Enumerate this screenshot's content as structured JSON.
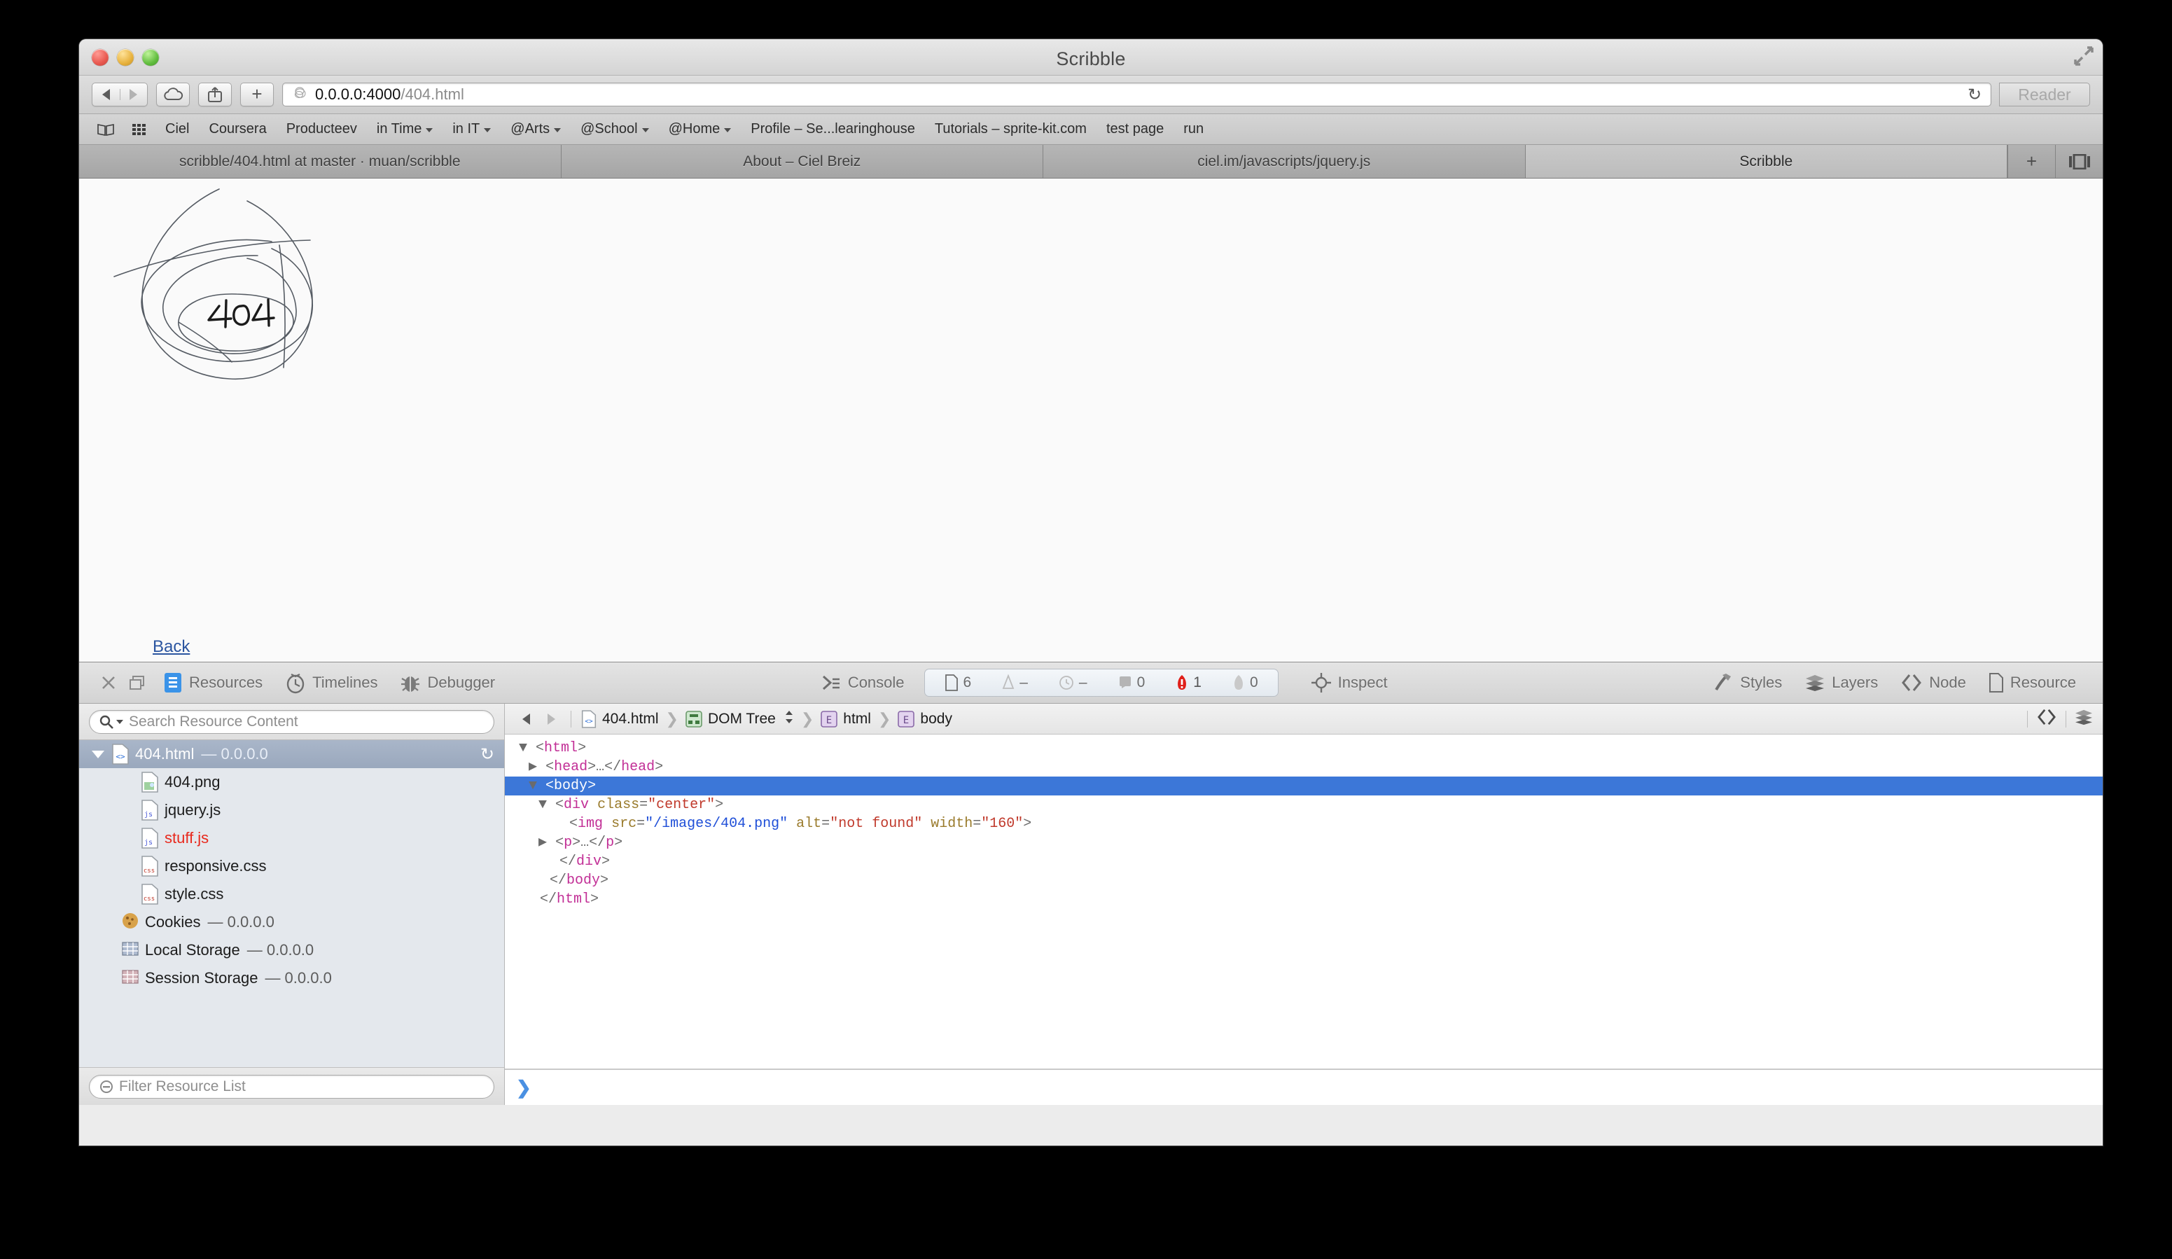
{
  "window": {
    "title": "Scribble"
  },
  "toolbar": {
    "url_host": "0.0.0.0:4000",
    "url_path": "/404.html",
    "reader_label": "Reader",
    "reload_glyph": "↻",
    "plus_glyph": "+"
  },
  "bookmarks": [
    {
      "label": "Ciel",
      "dropdown": false
    },
    {
      "label": "Coursera",
      "dropdown": false
    },
    {
      "label": "Producteev",
      "dropdown": false
    },
    {
      "label": "in Time",
      "dropdown": true
    },
    {
      "label": "in IT",
      "dropdown": true
    },
    {
      "label": "@Arts",
      "dropdown": true
    },
    {
      "label": "@School",
      "dropdown": true
    },
    {
      "label": "@Home",
      "dropdown": true
    },
    {
      "label": "Profile – Se...learinghouse",
      "dropdown": false
    },
    {
      "label": "Tutorials – sprite-kit.com",
      "dropdown": false
    },
    {
      "label": "test page",
      "dropdown": false
    },
    {
      "label": "run",
      "dropdown": false
    }
  ],
  "tabs": [
    {
      "label": "scribble/404.html at master · muan/scribble",
      "active": false
    },
    {
      "label": "About – Ciel Breiz",
      "active": false
    },
    {
      "label": "ciel.im/javascripts/jquery.js",
      "active": false
    },
    {
      "label": "Scribble",
      "active": true
    }
  ],
  "tab_buttons": {
    "new_tab": "+",
    "show_all_tabs": "show-all-tabs"
  },
  "page": {
    "scribble_label": "404",
    "back_link": "Back"
  },
  "inspector": {
    "close_glyph": "✕",
    "dock_glyph": "dock",
    "tabs": [
      {
        "label": "Resources",
        "icon": "resources-icon"
      },
      {
        "label": "Timelines",
        "icon": "timelines-icon"
      },
      {
        "label": "Debugger",
        "icon": "debugger-icon"
      },
      {
        "label": "Console",
        "icon": "console-icon"
      }
    ],
    "stats": [
      {
        "icon": "resource-count-icon",
        "value": "6"
      },
      {
        "icon": "size-icon",
        "value": "–"
      },
      {
        "icon": "time-icon",
        "value": "–"
      },
      {
        "icon": "log-icon",
        "value": "0"
      },
      {
        "icon": "error-icon",
        "value": "1"
      },
      {
        "icon": "warning-icon",
        "value": "0"
      }
    ],
    "inspect_label": "Inspect",
    "right_tabs": [
      {
        "label": "Styles",
        "icon": "styles-icon"
      },
      {
        "label": "Layers",
        "icon": "layers-icon"
      },
      {
        "label": "Node",
        "icon": "node-icon"
      },
      {
        "label": "Resource",
        "icon": "resource-icon"
      }
    ]
  },
  "sidebar": {
    "search_placeholder": "Search Resource Content",
    "filter_placeholder": "Filter Resource List",
    "items": [
      {
        "label": "404.html",
        "suffix": " — 0.0.0.0",
        "icon": "html-file-icon",
        "selected": true,
        "expandable": true,
        "depth": 0,
        "color": "default"
      },
      {
        "label": "404.png",
        "suffix": "",
        "icon": "image-file-icon",
        "selected": false,
        "expandable": false,
        "depth": 1,
        "color": "default"
      },
      {
        "label": "jquery.js",
        "suffix": "",
        "icon": "js-file-icon",
        "selected": false,
        "expandable": false,
        "depth": 1,
        "color": "default"
      },
      {
        "label": "stuff.js",
        "suffix": "",
        "icon": "js-file-icon",
        "selected": false,
        "expandable": false,
        "depth": 1,
        "color": "red"
      },
      {
        "label": "responsive.css",
        "suffix": "",
        "icon": "css-file-icon",
        "selected": false,
        "expandable": false,
        "depth": 1,
        "color": "default"
      },
      {
        "label": "style.css",
        "suffix": "",
        "icon": "css-file-icon",
        "selected": false,
        "expandable": false,
        "depth": 1,
        "color": "default"
      },
      {
        "label": "Cookies",
        "suffix": " — 0.0.0.0",
        "icon": "cookie-icon",
        "selected": false,
        "expandable": false,
        "depth": 0,
        "color": "default"
      },
      {
        "label": "Local Storage",
        "suffix": " — 0.0.0.0",
        "icon": "storage-icon",
        "selected": false,
        "expandable": false,
        "depth": 0,
        "color": "default"
      },
      {
        "label": "Session Storage",
        "suffix": " — 0.0.0.0",
        "icon": "session-storage-icon",
        "selected": false,
        "expandable": false,
        "depth": 0,
        "color": "default"
      }
    ]
  },
  "breadcrumb": [
    {
      "label": "404.html",
      "icon": "html-file-icon"
    },
    {
      "label": "DOM Tree",
      "icon": "dom-tree-icon",
      "stepper": true
    },
    {
      "label": "html",
      "icon": "element-icon"
    },
    {
      "label": "body",
      "icon": "element-icon"
    }
  ],
  "dom_tree": {
    "lines": [
      "<html>",
      "<head>…</head>",
      "<body>",
      "<div class=\"center\">",
      "<img src=\"/images/404.png\" alt=\"not found\" width=\"160\">",
      "<p>…</p>",
      "</div>",
      "</body>",
      "</html>"
    ],
    "selected_index": 2,
    "img_src": "/images/404.png",
    "img_alt": "not found",
    "img_width": "160",
    "div_class": "center"
  },
  "console": {
    "prompt_glyph": "❯"
  },
  "colors": {
    "selection_blue": "#3c77d8",
    "sidebar_selection": "#9aa8bd",
    "error_red": "#e8291d",
    "link_blue": "#2b55a0",
    "tag_pink": "#c22f96",
    "attr_olive": "#9a7b2c",
    "value_red": "#c0392b",
    "value_link_blue": "#1f4fd8"
  }
}
